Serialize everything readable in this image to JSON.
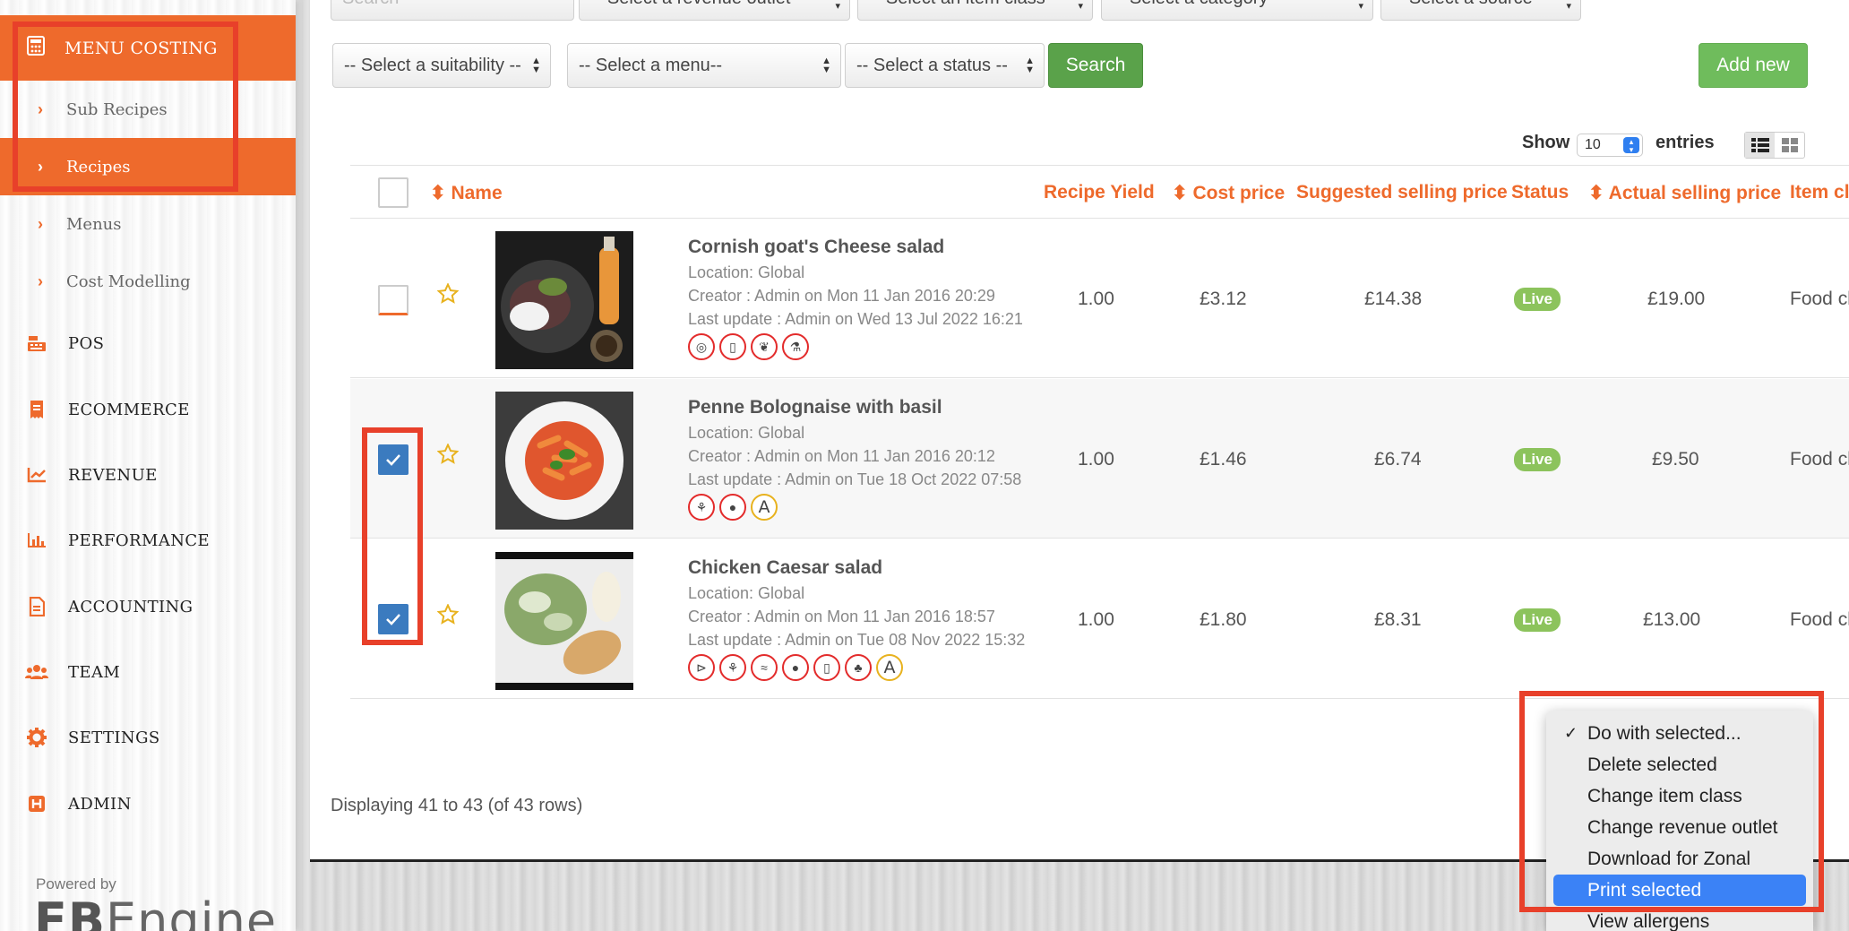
{
  "sidebar": {
    "section": "MENU COSTING",
    "sub_items": [
      "Sub Recipes",
      "Recipes",
      "Menus",
      "Cost Modelling"
    ],
    "active_sub": "Recipes",
    "items": [
      "POS",
      "ECOMMERCE",
      "REVENUE",
      "PERFORMANCE",
      "ACCOUNTING",
      "TEAM",
      "SETTINGS",
      "ADMIN"
    ],
    "powered_by": "Powered by",
    "logo_a": "FB",
    "logo_b": "Engine"
  },
  "filters": {
    "search_placeholder": "Search",
    "revenue_outlet": "-- Select a revenue outlet --",
    "item_class": "-- Select an item class --",
    "category": "-- Select a category --",
    "source": "-- Select a source --",
    "suitability": "-- Select a suitability --",
    "menu": "-- Select a menu--",
    "status": "-- Select a status --",
    "search_btn": "Search",
    "add_btn": "Add new"
  },
  "paging": {
    "show": "Show",
    "count": "10",
    "entries": "entries"
  },
  "table": {
    "headers": {
      "name": "Name",
      "yield": "Recipe Yield",
      "cost": "Cost price",
      "suggested": "Suggested selling price",
      "status": "Status",
      "actual": "Actual selling price",
      "item_class": "Item cl"
    },
    "rows": [
      {
        "name": "Cornish goat's Cheese salad",
        "location": "Location: Global",
        "creator": "Creator : Admin on Mon 11 Jan 2016 20:29",
        "updated": "Last update : Admin on Wed 13 Jul 2022 16:21",
        "yield": "1.00",
        "cost": "£3.12",
        "suggested": "£14.38",
        "status": "Live",
        "actual": "£19.00",
        "item_class": "Food cl",
        "checked": false
      },
      {
        "name": "Penne Bolognaise with basil",
        "location": "Location: Global",
        "creator": "Creator : Admin on Mon 11 Jan 2016 20:12",
        "updated": "Last update : Admin on Tue 18 Oct 2022 07:58",
        "yield": "1.00",
        "cost": "£1.46",
        "suggested": "£6.74",
        "status": "Live",
        "actual": "£9.50",
        "item_class": "Food cl",
        "checked": true
      },
      {
        "name": "Chicken Caesar salad",
        "location": "Location: Global",
        "creator": "Creator : Admin on Mon 11 Jan 2016 18:57",
        "updated": "Last update : Admin on Tue 08 Nov 2022 15:32",
        "yield": "1.00",
        "cost": "£1.80",
        "suggested": "£8.31",
        "status": "Live",
        "actual": "£13.00",
        "item_class": "Food cl",
        "checked": true
      }
    ]
  },
  "footer": {
    "displaying": "Displaying 41 to 43 (of 43 rows)"
  },
  "bulk_menu": {
    "options": [
      "Do with selected...",
      "Delete selected",
      "Change item class",
      "Change revenue outlet",
      "Download for Zonal",
      "Print selected",
      "View allergens"
    ],
    "selected": "Do with selected...",
    "highlighted": "Print selected"
  },
  "colors": {
    "accent": "#ee6a2c",
    "green": "#5aa24a",
    "live": "#8cc35c",
    "check": "#3b7bbf",
    "annotation": "#e8402a"
  }
}
